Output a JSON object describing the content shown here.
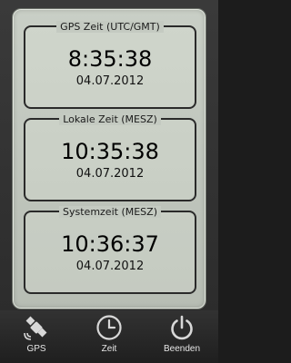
{
  "clocks": [
    {
      "title": "GPS Zeit (UTC/GMT)",
      "time": "8:35:38",
      "date": "04.07.2012"
    },
    {
      "title": "Lokale Zeit (MESZ)",
      "time": "10:35:38",
      "date": "04.07.2012"
    },
    {
      "title": "Systemzeit (MESZ)",
      "time": "10:36:37",
      "date": "04.07.2012"
    }
  ],
  "nav": {
    "items": [
      {
        "label": "GPS",
        "icon": "satellite-icon"
      },
      {
        "label": "Zeit",
        "icon": "clock-icon"
      },
      {
        "label": "Beenden",
        "icon": "power-icon"
      }
    ]
  },
  "colors": {
    "panel": "#c1c7be",
    "frame": "#2a2a2a",
    "navbar": "#2a2a2a"
  }
}
